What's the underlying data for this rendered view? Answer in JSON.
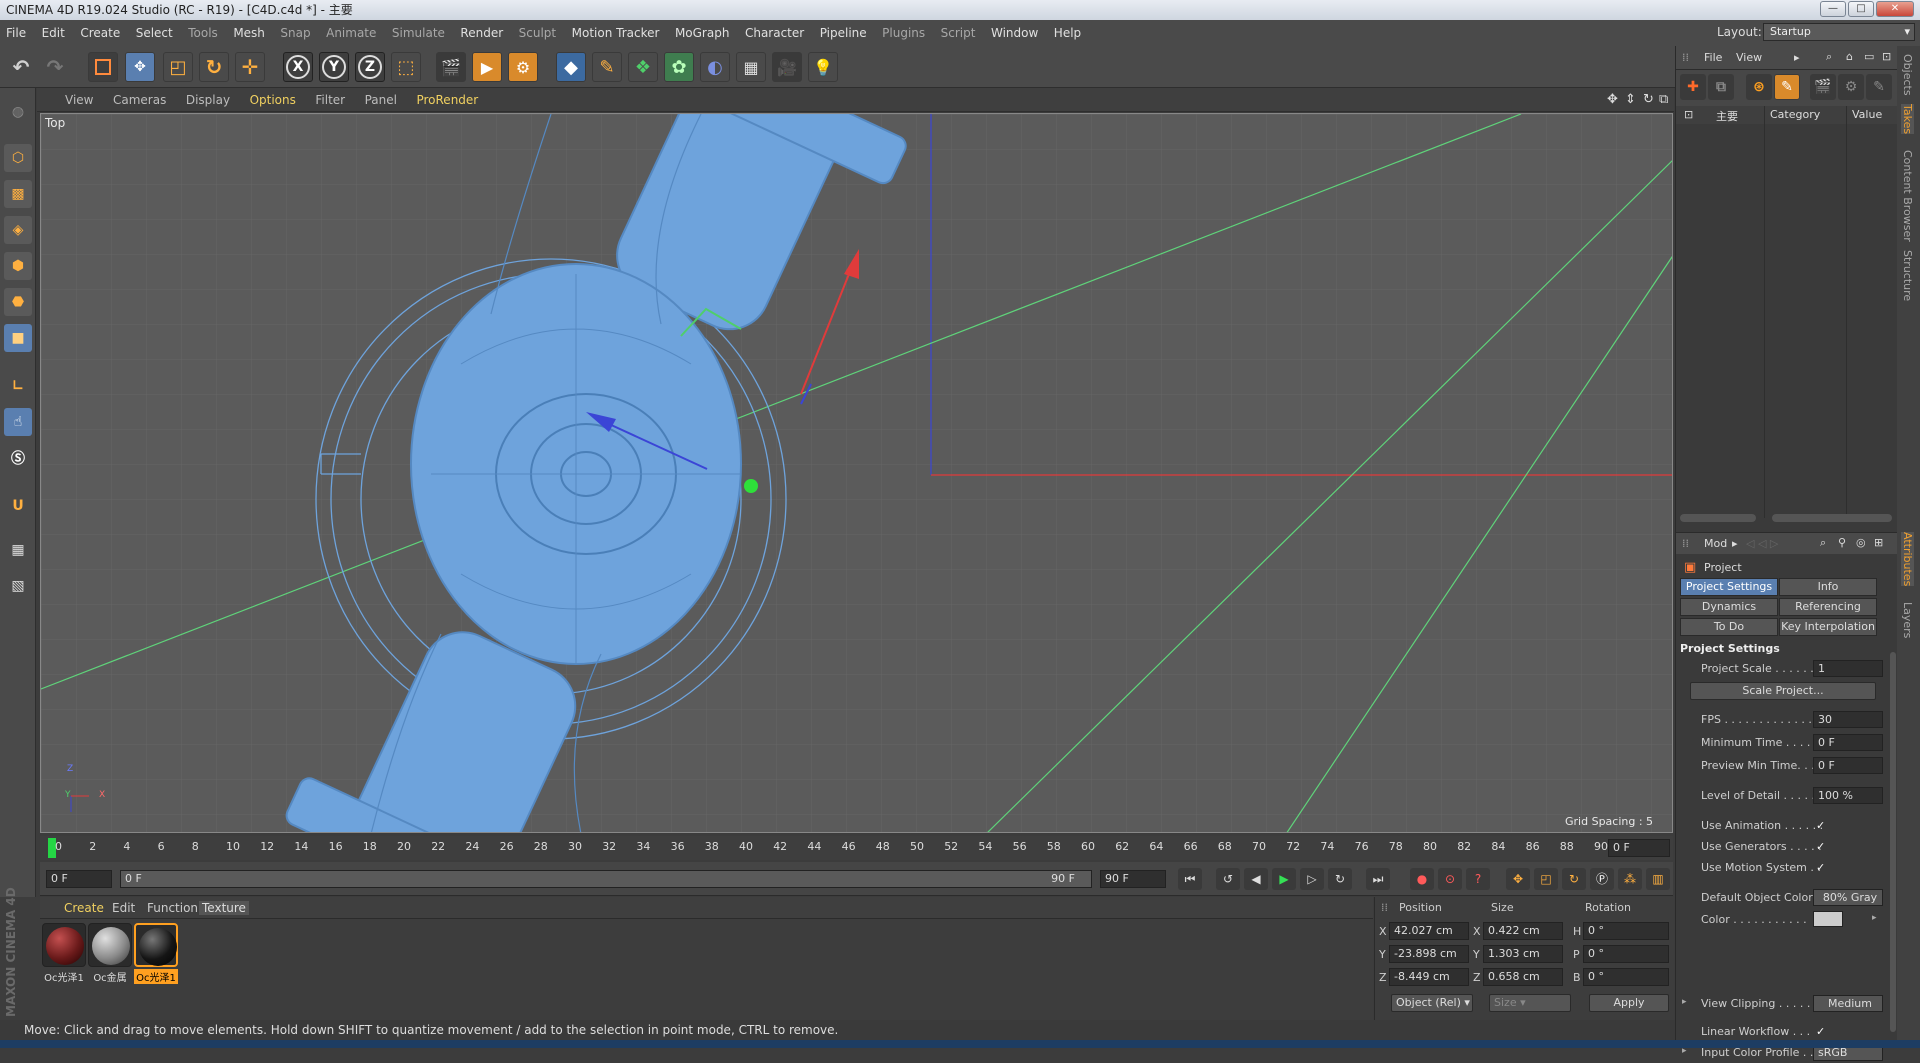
{
  "window": {
    "title": "CINEMA 4D R19.024 Studio (RC - R19) - [C4D.c4d *] - 主要",
    "layout_label": "Layout:",
    "layout_value": "Startup"
  },
  "menubar": {
    "items": [
      "File",
      "Edit",
      "Create",
      "Select",
      "Tools",
      "Mesh",
      "Snap",
      "Animate",
      "Simulate",
      "Render",
      "Sculpt",
      "Motion Tracker",
      "MoGraph",
      "Character",
      "Pipeline",
      "Plugins",
      "Script",
      "Window",
      "Help"
    ]
  },
  "toolbar": {
    "axis_x": "X",
    "axis_y": "Y",
    "axis_z": "Z"
  },
  "viewport": {
    "menu": [
      "View",
      "Cameras",
      "Display",
      "Options",
      "Filter",
      "Panel",
      "ProRender"
    ],
    "view_name": "Top",
    "grid_spacing": "Grid Spacing : 5 cm",
    "axis_labels": {
      "z": "Z",
      "y": "Y",
      "x": "X"
    }
  },
  "timeline": {
    "ticks": [
      "0",
      "2",
      "4",
      "6",
      "8",
      "10",
      "12",
      "14",
      "16",
      "18",
      "20",
      "22",
      "24",
      "26",
      "28",
      "30",
      "32",
      "34",
      "36",
      "38",
      "40",
      "42",
      "44",
      "46",
      "48",
      "50",
      "52",
      "54",
      "56",
      "58",
      "60",
      "62",
      "64",
      "66",
      "68",
      "70",
      "72",
      "74",
      "76",
      "78",
      "80",
      "82",
      "84",
      "86",
      "88",
      "90"
    ],
    "current_frame": "0 F",
    "start_frame": "0 F",
    "range_start": "0 F",
    "range_end": "90 F",
    "end_frame": "90 F"
  },
  "materials": {
    "menu": [
      "Create",
      "Edit",
      "Function",
      "Texture"
    ],
    "items": [
      {
        "label": "Oc光泽1",
        "color": "#6a1a1a"
      },
      {
        "label": "Oc金属",
        "color": "#8a8a8a"
      },
      {
        "label": "Oc光泽1",
        "color": "#151515"
      }
    ],
    "brand": "MAXON CINEMA 4D"
  },
  "coordinates": {
    "headers": [
      "Position",
      "Size",
      "Rotation"
    ],
    "rows": [
      {
        "axis": "X",
        "pos": "42.027 cm",
        "size_axis": "X",
        "size": "0.422 cm",
        "rot_axis": "H",
        "rot": "0 °"
      },
      {
        "axis": "Y",
        "pos": "-23.898 cm",
        "size_axis": "Y",
        "size": "1.303 cm",
        "rot_axis": "P",
        "rot": "0 °"
      },
      {
        "axis": "Z",
        "pos": "-8.449 cm",
        "size_axis": "Z",
        "size": "0.658 cm",
        "rot_axis": "B",
        "rot": "0 °"
      }
    ],
    "mode": "Object (Rel)",
    "size_mode": "Size",
    "apply": "Apply"
  },
  "objects_panel": {
    "menu": [
      "File",
      "View"
    ],
    "take_name": "主要",
    "col_category": "Category",
    "col_value": "Value"
  },
  "attributes": {
    "mode_label": "Mod",
    "object": "Project",
    "tabs": [
      {
        "label": "Project Settings",
        "active": true
      },
      {
        "label": "Info",
        "active": false
      },
      {
        "label": "Dynamics",
        "active": false
      },
      {
        "label": "Referencing",
        "active": false
      },
      {
        "label": "To Do",
        "active": false
      },
      {
        "label": "Key Interpolation",
        "active": false
      }
    ],
    "section": "Project Settings",
    "project_scale_label": "Project Scale . . . . . .",
    "project_scale": "1",
    "scale_project_btn": "Scale Project...",
    "fps_label": "FPS . . . . . . . . . . . . . . .",
    "fps": "30",
    "min_time_label": "Minimum Time . . . . .",
    "min_time": "0 F",
    "preview_min_label": "Preview Min Time. . .",
    "preview_min": "0 F",
    "lod_label": "Level of Detail . . . . .",
    "lod": "100 %",
    "use_animation": "Use Animation . . . . . .",
    "use_generators": "Use Generators . . . . .",
    "use_motion": "Use Motion System . .",
    "default_color_label": "Default Object Color",
    "default_color": "80% Gray",
    "color_label": "Color . . . . . . . . . . .",
    "view_clipping_label": "View Clipping . . . . .",
    "view_clipping": "Medium",
    "linear_workflow": "Linear Workflow . . .",
    "input_profile_label": "Input Color Profile . .",
    "input_profile": "sRGB",
    "check": "✓"
  },
  "right_tabs": [
    "Objects",
    "Takes",
    "Content Browser",
    "Structure",
    "Attributes",
    "Layers"
  ],
  "status": "Move: Click and drag to move elements. Hold down SHIFT to quantize movement / add to the selection in point mode, CTRL to remove.",
  "colors": {
    "mesh": "#5b93cf",
    "accent": "#5a7fb0",
    "grid_green": "#5fd37a",
    "axis_red": "#e03b3b",
    "axis_blue": "#3b45d6"
  }
}
